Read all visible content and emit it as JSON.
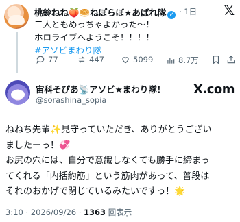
{
  "reply_tweet": {
    "display_name": "桃鈴ねね🍑🥯ねぽらぼ★あばれ隊",
    "time": "1日",
    "lines": [
      "二人ともめっちゃよかった〜！",
      "ホロライブへようこそ！！！！"
    ],
    "hashtag": "#アソビまわり隊",
    "actions": {
      "replies": "77",
      "reposts": "447",
      "likes": "5099",
      "views": "8.7万"
    }
  },
  "main_tweet": {
    "display_name": "宙科そぴあ📡アソビ★まわり隊！",
    "handle": "@sorashina_sopia",
    "site_mark": "X.com",
    "body_lines": [
      "ねねち先輩✨見守っていただき、ありがとうござい",
      "ましたーっ！💞",
      "お尻の穴には、自分で意識しなくても勝手に締まっ",
      "てくれる「内括約筋」という筋肉があって、普段は",
      "それのおかげで閉じているみたいですっ！🌟"
    ],
    "footer": {
      "timestamp": "3:10 · 2026/09/26 · ",
      "views_count": "1363",
      "views_label": " 回表示"
    }
  }
}
